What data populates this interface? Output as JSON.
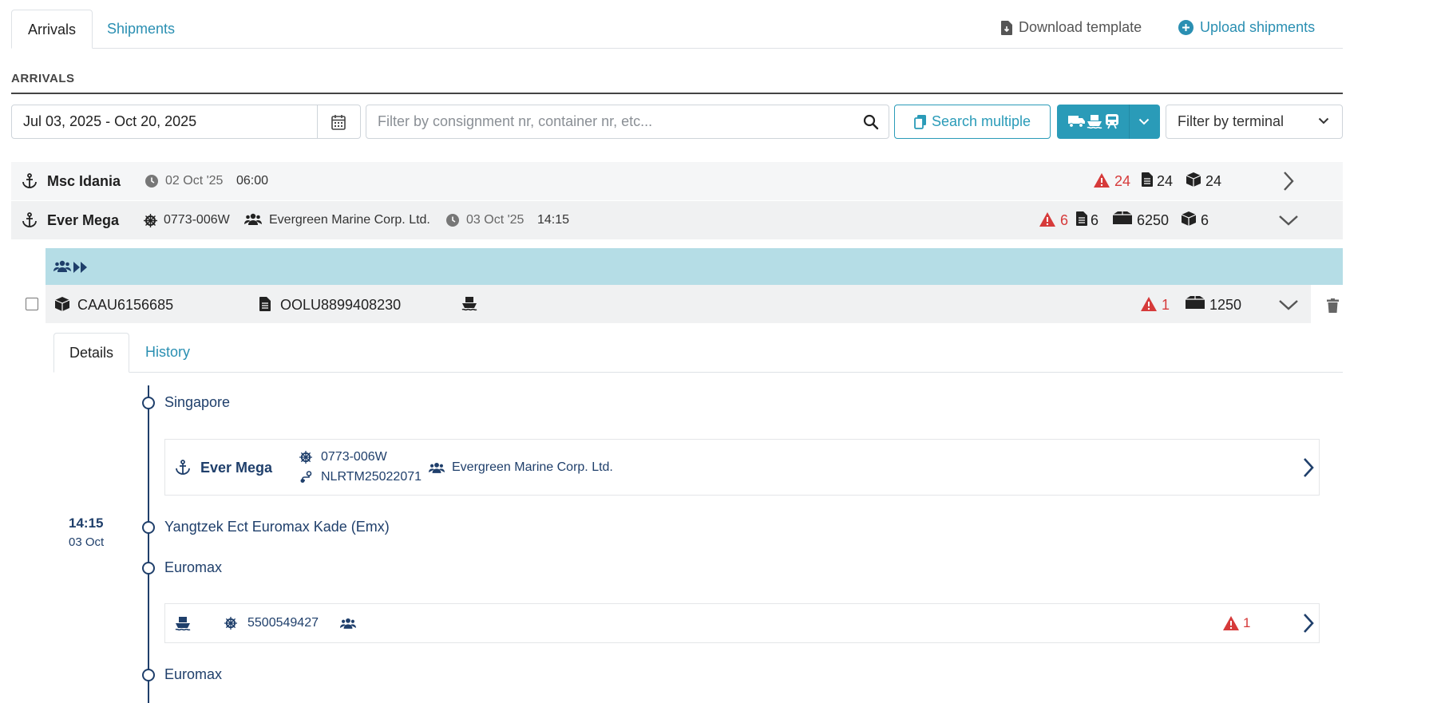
{
  "tabs": {
    "arrivals": "Arrivals",
    "shipments": "Shipments"
  },
  "actions": {
    "download_template": "Download template",
    "upload_shipments": "Upload shipments"
  },
  "section_title": "ARRIVALS",
  "filters": {
    "date_range": "Jul 03, 2025 - Oct 20, 2025",
    "search_placeholder": "Filter by consignment nr, container nr, etc...",
    "search_multiple": "Search multiple",
    "terminal_placeholder": "Filter by terminal"
  },
  "arrivals": [
    {
      "vessel": "Msc Idania",
      "date": "02 Oct '25",
      "time": "06:00",
      "warnings": "24",
      "documents": "24",
      "containers": "24"
    },
    {
      "vessel": "Ever Mega",
      "voyage": "0773-006W",
      "carrier": "Evergreen Marine Corp. Ltd.",
      "date": "03 Oct '25",
      "time": "14:15",
      "warnings": "6",
      "documents": "6",
      "packages": "6250",
      "containers": "6"
    }
  ],
  "shipment": {
    "container": "CAAU6156685",
    "bill_of_lading": "OOLU8899408230",
    "warnings": "1",
    "packages": "1250"
  },
  "detail_tabs": {
    "details": "Details",
    "history": "History"
  },
  "timeline": {
    "stop1": "Singapore",
    "leg1": {
      "vessel": "Ever Mega",
      "voyage": "0773-006W",
      "reference": "NLRTM25022071",
      "carrier": "Evergreen Marine Corp. Ltd."
    },
    "arrival_time": "14:15",
    "arrival_date": "03 Oct",
    "stop2": "Yangtzek Ect Euromax Kade (Emx)",
    "stop3": "Euromax",
    "leg2": {
      "voyage": "5500549427",
      "warnings": "1"
    },
    "stop4": "Euromax"
  }
}
